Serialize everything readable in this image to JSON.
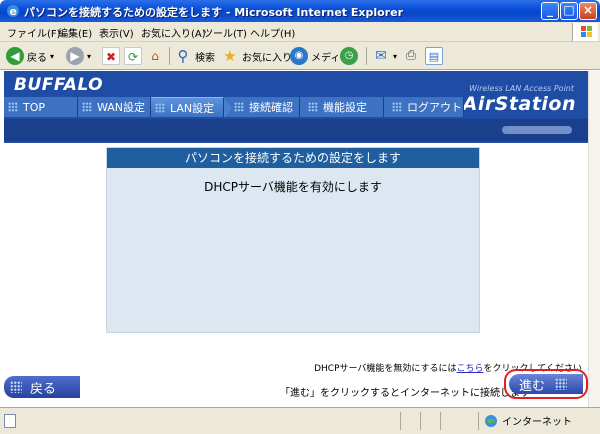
{
  "window": {
    "title": "パソコンを接続するための設定をします - Microsoft Internet Explorer",
    "minimize": "_",
    "maximize": "□",
    "close": "×"
  },
  "menu": [
    "ファイル(F)",
    "編集(E)",
    "表示(V)",
    "お気に入り(A)",
    "ツール(T)",
    "ヘルプ(H)"
  ],
  "toolbar": {
    "back_label": "戻る",
    "search_label": "検索",
    "favorites_label": "お気に入り",
    "media_label": "メディア"
  },
  "header": {
    "logo": "BUFFALO",
    "tagline": "Wireless LAN Access Point",
    "brand": "AirStation",
    "tabs": [
      "TOP",
      "WAN設定",
      "LAN設定",
      "接続確認",
      "機能設定",
      "ログアウト"
    ],
    "active_tab": "LAN設定"
  },
  "panel": {
    "title": "パソコンを接続するための設定をします",
    "message": "DHCPサーバ機能を有効にします"
  },
  "note": {
    "prefix": "DHCPサーバ機能を無効にするには",
    "link": "こちら",
    "suffix": "をクリックしてください"
  },
  "nav": {
    "back_label": "戻る",
    "instruction": "「進む」をクリックするとインターネットに接続します",
    "next_label": "進む"
  },
  "status": {
    "zone": "インターネット"
  },
  "colors": {
    "header_blue": "#1f4da6",
    "panel_title_blue": "#1f5fa0",
    "panel_bg": "#dce7f1",
    "highlight_red": "#e02020"
  }
}
